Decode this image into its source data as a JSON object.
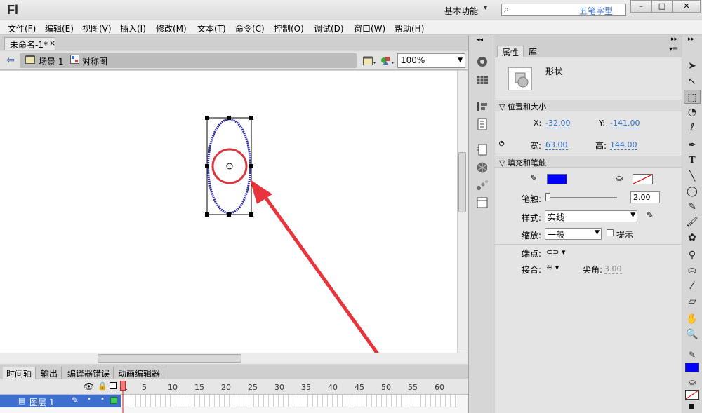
{
  "app": {
    "logo": "Fl",
    "workspace": "基本功能",
    "search_text": "五笔字型",
    "window_buttons": [
      "–",
      "□",
      "✕"
    ]
  },
  "menu": [
    "文件(F)",
    "编辑(E)",
    "视图(V)",
    "插入(I)",
    "修改(M)",
    "文本(T)",
    "命令(C)",
    "控制(O)",
    "调试(D)",
    "窗口(W)",
    "帮助(H)"
  ],
  "document": {
    "tab_title": "未命名-1*",
    "tab_close": "×",
    "breadcrumb_scene": "场景 1",
    "breadcrumb_symbol": "对称图",
    "zoom": "100%"
  },
  "timeline": {
    "tabs": [
      "时间轴",
      "输出",
      "编译器错误",
      "动画编辑器"
    ],
    "frame_numbers": [
      "1",
      "5",
      "10",
      "15",
      "20",
      "25",
      "30",
      "35",
      "40",
      "45",
      "50",
      "55",
      "60"
    ],
    "layer_name": "图层 1"
  },
  "properties": {
    "tabs": [
      "属性",
      "库"
    ],
    "object_type": "形状",
    "section_position": "位置和大小",
    "x_label": "X:",
    "x_value": "-32.00",
    "y_label": "Y:",
    "y_value": "-141.00",
    "width_label": "宽:",
    "width_value": "63.00",
    "height_label": "高:",
    "height_value": "144.00",
    "section_fill": "填充和笔触",
    "stroke_color": "#0000ff",
    "stroke_label": "笔触:",
    "stroke_size": "2.00",
    "style_label": "样式:",
    "style_value": "实线",
    "scale_label": "缩放:",
    "scale_value": "一般",
    "hint_label": "提示",
    "cap_label": "端点:",
    "join_label": "接合:",
    "miter_label": "尖角:",
    "miter_value": "3.00"
  },
  "colors": {
    "stroke": "#0000ff",
    "ellipse": "#2e2ea8",
    "circle": "#d9363e",
    "arrow": "#e8343c",
    "layer_highlight": "#3e6fd0"
  }
}
